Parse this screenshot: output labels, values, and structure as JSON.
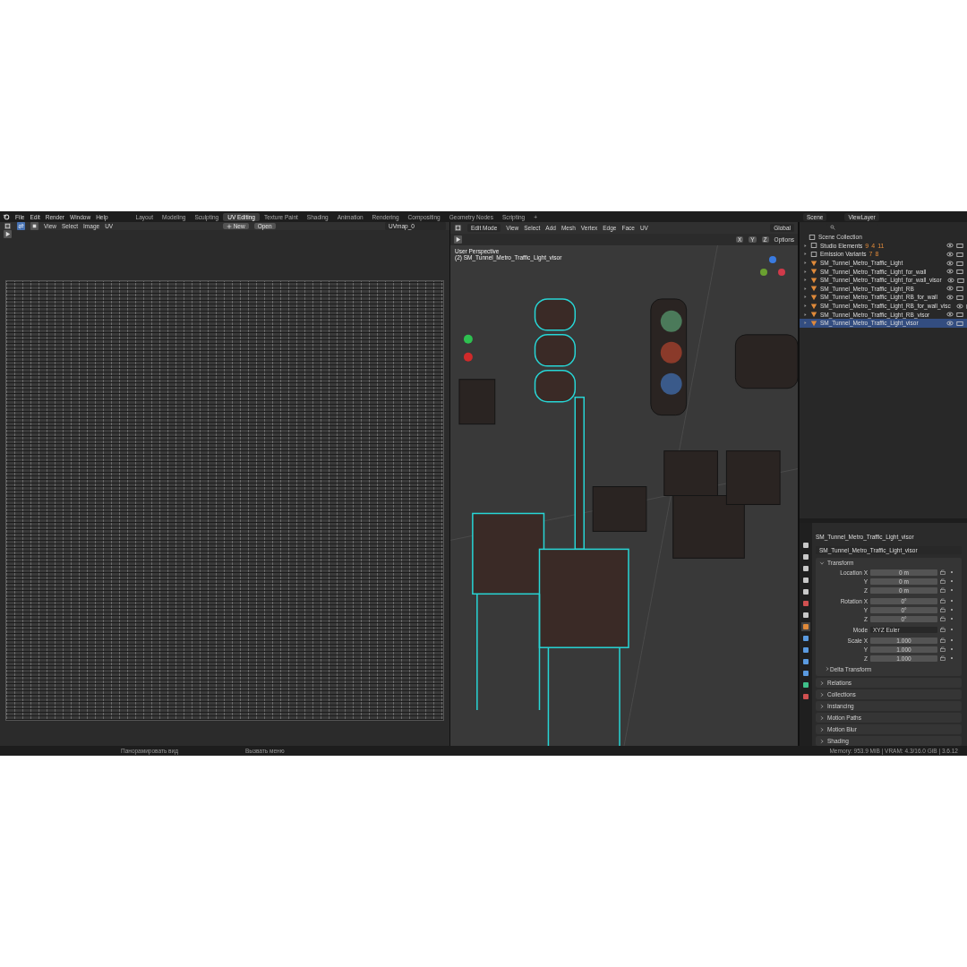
{
  "topbar": {
    "menus": [
      "File",
      "Edit",
      "Render",
      "Window",
      "Help"
    ],
    "workspaces": [
      {
        "label": "Layout",
        "selected": false
      },
      {
        "label": "Modeling",
        "selected": false
      },
      {
        "label": "Sculpting",
        "selected": false
      },
      {
        "label": "UV Editing",
        "selected": true
      },
      {
        "label": "Texture Paint",
        "selected": false
      },
      {
        "label": "Shading",
        "selected": false
      },
      {
        "label": "Animation",
        "selected": false
      },
      {
        "label": "Rendering",
        "selected": false
      },
      {
        "label": "Compositing",
        "selected": false
      },
      {
        "label": "Geometry Nodes",
        "selected": false
      },
      {
        "label": "Scripting",
        "selected": false
      }
    ],
    "add_tab": "+",
    "scene": "Scene",
    "view_layer": "ViewLayer"
  },
  "uv_editor": {
    "menus": [
      "View",
      "Select",
      "Image",
      "UV"
    ],
    "new_button": "New",
    "open_button": "Open",
    "uv_map": "UVmap_0"
  },
  "viewport": {
    "mode": "Edit Mode",
    "menus": [
      "View",
      "Select",
      "Add",
      "Mesh",
      "Vertex",
      "Edge",
      "Face",
      "UV"
    ],
    "orientation": "Global",
    "axes": [
      "X",
      "Y",
      "Z"
    ],
    "options": "Options",
    "view_name": "User Perspective",
    "object_label": "(2) SM_Tunnel_Metro_Traffic_Light_visor"
  },
  "outliner": {
    "root": "Scene Collection",
    "items": [
      {
        "name": "Studio Elements",
        "kind": "collection",
        "counts": [
          "9",
          "4",
          "11"
        ],
        "selected": false
      },
      {
        "name": "Emission Variants",
        "kind": "collection",
        "counts": [
          "7",
          "8"
        ],
        "selected": false
      },
      {
        "name": "SM_Tunnel_Metro_Traffic_Light",
        "kind": "mesh",
        "selected": false
      },
      {
        "name": "SM_Tunnel_Metro_Traffic_Light_for_wall",
        "kind": "mesh",
        "selected": false
      },
      {
        "name": "SM_Tunnel_Metro_Traffic_Light_for_wall_visor",
        "kind": "mesh",
        "selected": false
      },
      {
        "name": "SM_Tunnel_Metro_Traffic_Light_RB",
        "kind": "mesh",
        "selected": false
      },
      {
        "name": "SM_Tunnel_Metro_Traffic_Light_RB_for_wall",
        "kind": "mesh",
        "selected": false
      },
      {
        "name": "SM_Tunnel_Metro_Traffic_Light_RB_for_wall_visc",
        "kind": "mesh",
        "selected": false
      },
      {
        "name": "SM_Tunnel_Metro_Traffic_Light_RB_visor",
        "kind": "mesh",
        "selected": false
      },
      {
        "name": "SM_Tunnel_Metro_Traffic_Light_visor",
        "kind": "mesh",
        "selected": true
      }
    ]
  },
  "properties": {
    "object_name": "SM_Tunnel_Metro_Traffic_Light_visor",
    "data_name": "SM_Tunnel_Metro_Traffic_Light_visor",
    "transform": {
      "title": "Transform",
      "expanded": true,
      "rows": [
        {
          "label": "Location X",
          "value": "0 m",
          "kind": "number"
        },
        {
          "label": "Y",
          "value": "0 m",
          "kind": "number"
        },
        {
          "label": "Z",
          "value": "0 m",
          "kind": "number"
        },
        {
          "label": "Rotation X",
          "value": "0°",
          "kind": "number"
        },
        {
          "label": "Y",
          "value": "0°",
          "kind": "number"
        },
        {
          "label": "Z",
          "value": "0°",
          "kind": "number"
        },
        {
          "label": "Mode",
          "value": "XYZ Euler",
          "kind": "dropdown"
        },
        {
          "label": "Scale X",
          "value": "1.000",
          "kind": "number"
        },
        {
          "label": "Y",
          "value": "1.000",
          "kind": "number"
        },
        {
          "label": "Z",
          "value": "1.000",
          "kind": "number"
        }
      ],
      "subpanel": {
        "title": "Delta Transform",
        "expanded": false
      }
    },
    "panels": [
      {
        "title": "Relations",
        "expanded": false
      },
      {
        "title": "Collections",
        "expanded": false
      },
      {
        "title": "Instancing",
        "expanded": false
      },
      {
        "title": "Motion Paths",
        "expanded": false
      },
      {
        "title": "Motion Blur",
        "expanded": false
      },
      {
        "title": "Shading",
        "expanded": false
      }
    ]
  },
  "status_bar": {
    "hints": [
      "Панорамировать вид",
      "Вызвать меню"
    ],
    "info": "Memory: 953.9 MiB | VRAM: 4.3/16.0 GiB | 3.6.12"
  }
}
